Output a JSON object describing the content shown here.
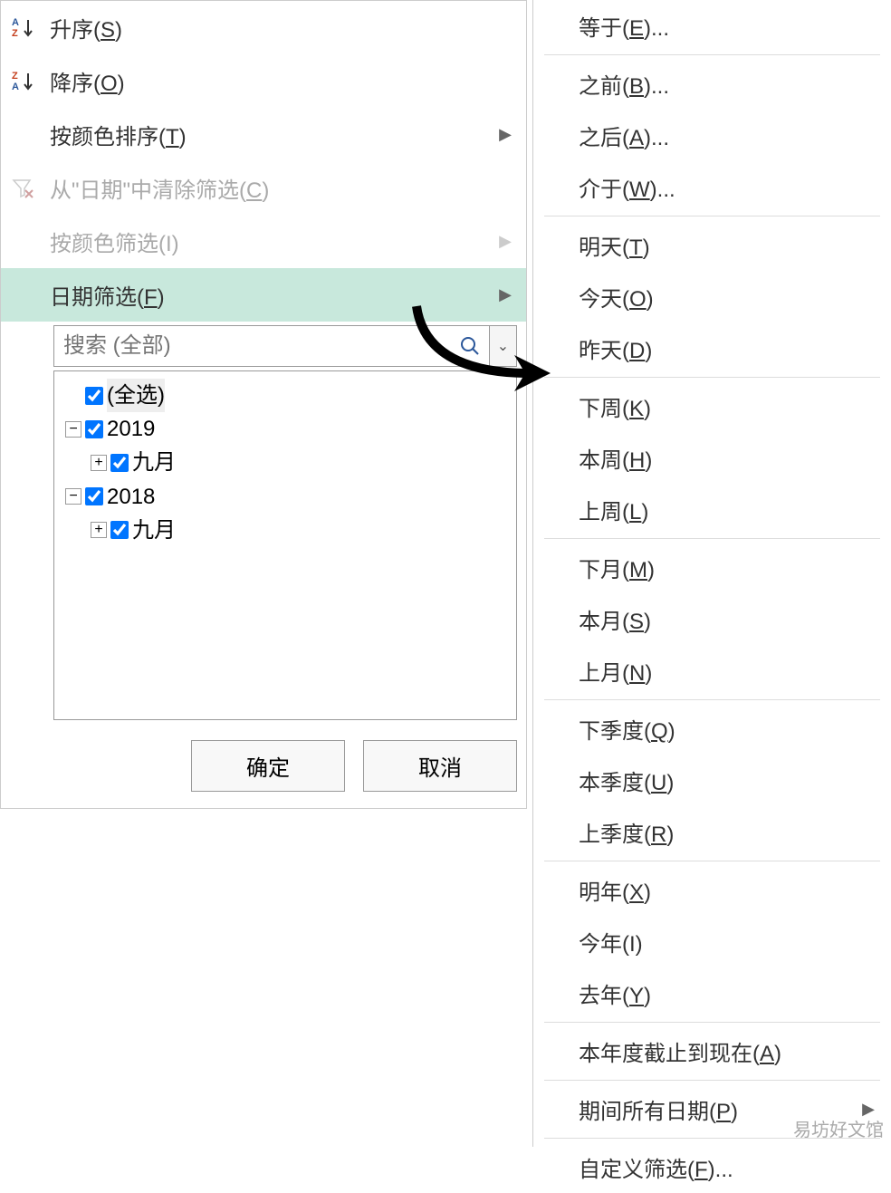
{
  "leftPanel": {
    "sortAsc": "升序(<u>S</u>)",
    "sortDesc": "降序(<u>O</u>)",
    "sortByColor": "按颜色排序(<u>T</u>)",
    "clearFilter": "从\"日期\"中清除筛选(<u>C</u>)",
    "filterByColor": "按颜色筛选(I)",
    "dateFilter": "日期筛选(<u>F</u>)",
    "searchPlaceholder": "搜索 (全部)",
    "tree": {
      "selectAll": "(全选)",
      "year1": "2019",
      "year1month": "九月",
      "year2": "2018",
      "year2month": "九月"
    },
    "ok": "确定",
    "cancel": "取消"
  },
  "rightPanel": {
    "equals": "等于(<u>E</u>)...",
    "before": "之前(<u>B</u>)...",
    "after": "之后(<u>A</u>)...",
    "between": "介于(<u>W</u>)...",
    "tomorrow": "明天(<u>T</u>)",
    "today": "今天(<u>O</u>)",
    "yesterday": "昨天(<u>D</u>)",
    "nextWeek": "下周(<u>K</u>)",
    "thisWeek": "本周(<u>H</u>)",
    "lastWeek": "上周(<u>L</u>)",
    "nextMonth": "下月(<u>M</u>)",
    "thisMonth": "本月(<u>S</u>)",
    "lastMonth": "上月(<u>N</u>)",
    "nextQuarter": "下季度(<u>Q</u>)",
    "thisQuarter": "本季度(<u>U</u>)",
    "lastQuarter": "上季度(<u>R</u>)",
    "nextYear": "明年(<u>X</u>)",
    "thisYear": "今年(I)",
    "lastYear": "去年(<u>Y</u>)",
    "ytd": "本年度截止到现在(<u>A</u>)",
    "allDates": "期间所有日期(<u>P</u>)",
    "custom": "自定义筛选(<u>F</u>)..."
  },
  "watermark": "易坊好文馆"
}
